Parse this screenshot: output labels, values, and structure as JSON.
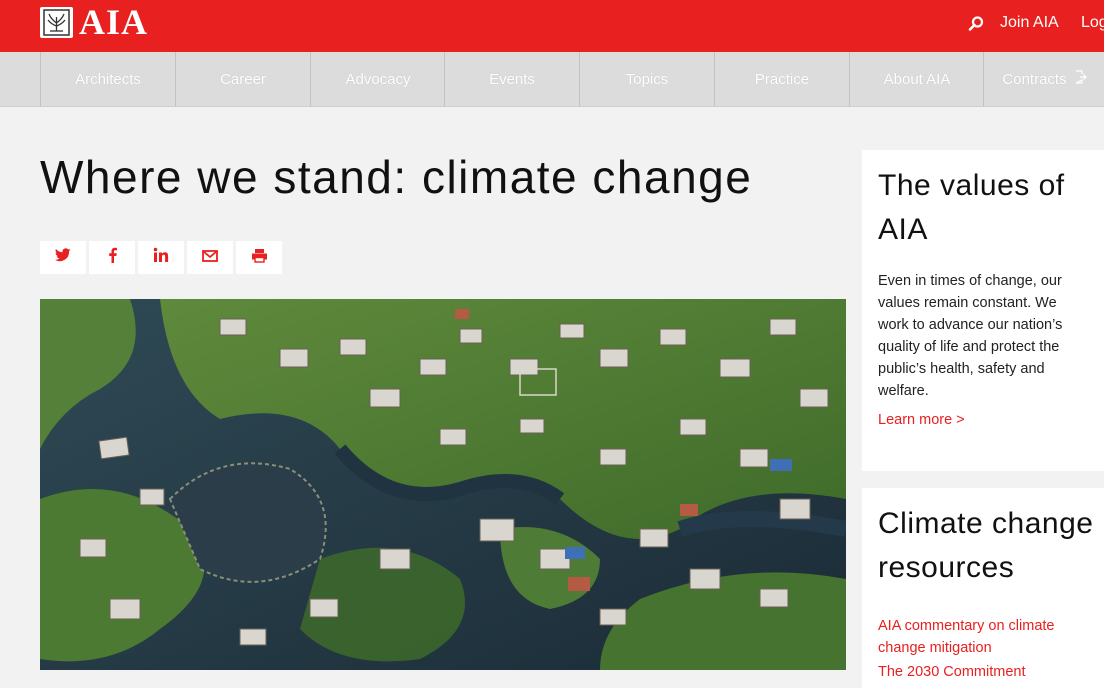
{
  "header": {
    "logo_text": "AIA",
    "join_label": "Join AIA",
    "login_label": "Log",
    "brand_color": "#e8201f"
  },
  "nav": {
    "items": [
      {
        "label": "Architects"
      },
      {
        "label": "Career"
      },
      {
        "label": "Advocacy"
      },
      {
        "label": "Events"
      },
      {
        "label": "Topics"
      },
      {
        "label": "Practice"
      },
      {
        "label": "About AIA"
      },
      {
        "label": "Contracts",
        "icon": "external-link-icon"
      }
    ]
  },
  "page": {
    "title": "Where we stand: climate change"
  },
  "share": {
    "icons": [
      "twitter-icon",
      "facebook-icon",
      "linkedin-icon",
      "email-icon",
      "print-icon"
    ]
  },
  "sidebar": {
    "values_card": {
      "title": "The values of AIA",
      "body": "Even in times of change, our values remain constant. We work to advance our nation’s quality of life and protect the public’s health, safety and welfare.",
      "link": "Learn more >"
    },
    "resources_card": {
      "title": "Climate change resources",
      "links": [
        {
          "label": "AIA commentary on climate change mitigation"
        },
        {
          "label": "The 2030 Commitment"
        }
      ]
    }
  }
}
